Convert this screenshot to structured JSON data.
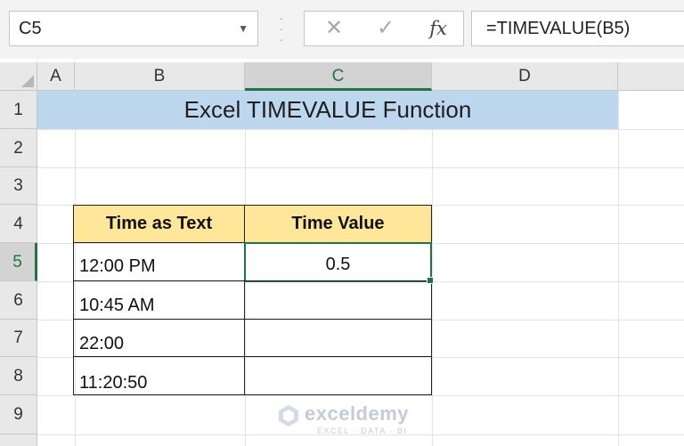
{
  "formula_bar": {
    "name_box": "C5",
    "name_box_dropdown_icon": "chevron-down-icon",
    "cancel_icon": "x-icon",
    "enter_icon": "checkmark-icon",
    "function_label": "fx",
    "formula": "=TIMEVALUE(B5)"
  },
  "columns": [
    "A",
    "B",
    "C",
    "D"
  ],
  "selected_column": "C",
  "rows": [
    "1",
    "2",
    "3",
    "4",
    "5",
    "6",
    "7",
    "8",
    "9"
  ],
  "selected_row": "5",
  "sheet": {
    "title": "Excel TIMEVALUE Function",
    "table": {
      "headers": [
        "Time as Text",
        "Time Value"
      ],
      "rows": [
        {
          "text": "12:00 PM",
          "value": "0.5"
        },
        {
          "text": "10:45 AM",
          "value": ""
        },
        {
          "text": "22:00",
          "value": ""
        },
        {
          "text": "11:20:50",
          "value": ""
        }
      ]
    }
  },
  "colors": {
    "title_band": "#bdd7ee",
    "table_header": "#ffe699",
    "selection_accent": "#217346"
  },
  "watermark": {
    "name": "exceldemy",
    "tagline": "EXCEL · DATA · BI"
  }
}
